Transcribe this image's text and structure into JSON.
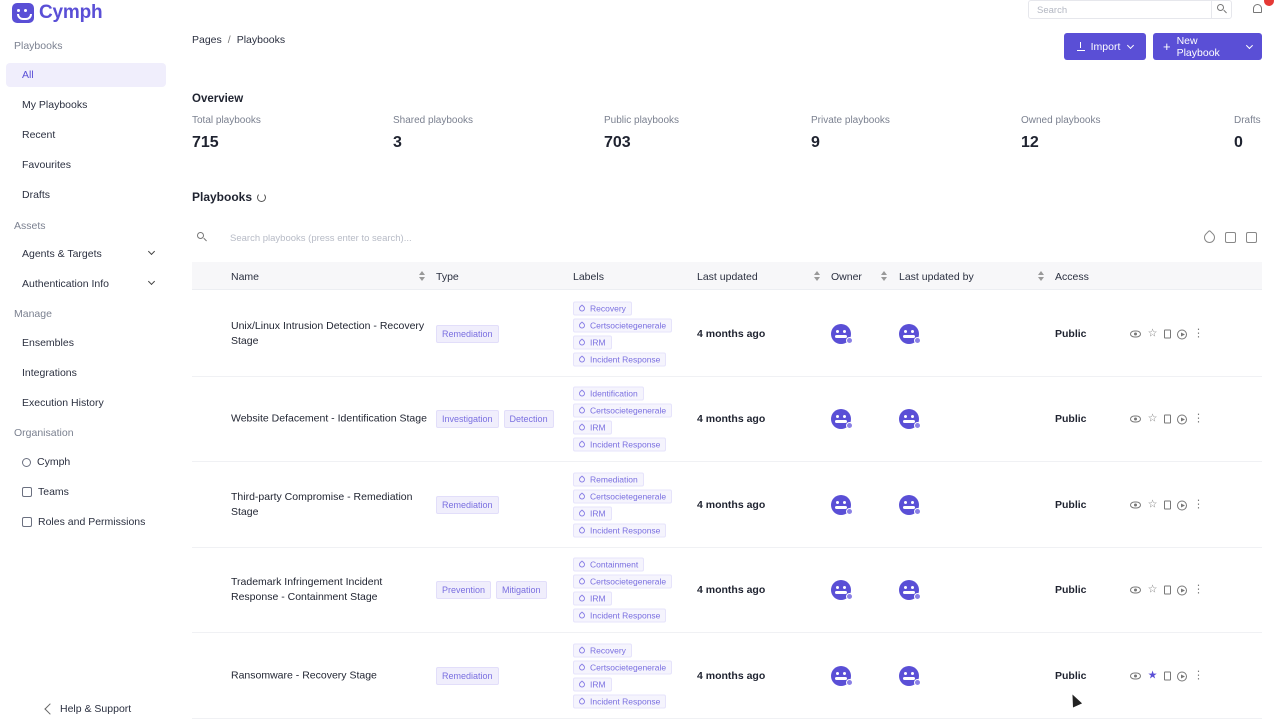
{
  "app": {
    "name": "Cymph"
  },
  "sidebar": {
    "sections": [
      {
        "label": "Playbooks"
      },
      {
        "label": "Assets"
      },
      {
        "label": "Manage"
      },
      {
        "label": "Organisation"
      }
    ],
    "playbooks": [
      {
        "label": "All",
        "active": true
      },
      {
        "label": "My Playbooks"
      },
      {
        "label": "Recent"
      },
      {
        "label": "Favourites"
      },
      {
        "label": "Drafts"
      }
    ],
    "assets": [
      {
        "label": "Agents & Targets"
      },
      {
        "label": "Authentication Info"
      }
    ],
    "manage": [
      {
        "label": "Ensembles"
      },
      {
        "label": "Integrations"
      },
      {
        "label": "Execution History"
      }
    ],
    "organisation": [
      {
        "label": "Cymph",
        "icon": "people-icon"
      },
      {
        "label": "Teams",
        "icon": "teams-icon"
      },
      {
        "label": "Roles and Permissions",
        "icon": "roles-icon"
      }
    ],
    "help": "Help & Support"
  },
  "topbar": {
    "search_placeholder": "Search"
  },
  "breadcrumb": [
    "Pages",
    "/",
    "Playbooks"
  ],
  "buttons": {
    "import": "Import",
    "new_playbook": "New Playbook"
  },
  "overview": {
    "title": "Overview",
    "stats": [
      {
        "label": "Total playbooks",
        "value": "715"
      },
      {
        "label": "Shared playbooks",
        "value": "3"
      },
      {
        "label": "Public playbooks",
        "value": "703"
      },
      {
        "label": "Private playbooks",
        "value": "9"
      },
      {
        "label": "Owned playbooks",
        "value": "12"
      },
      {
        "label": "Drafts",
        "value": "0"
      }
    ]
  },
  "playbooks": {
    "title": "Playbooks",
    "search_placeholder": "Search playbooks (press enter to search)...",
    "columns": [
      "Name",
      "Type",
      "Labels",
      "Last updated",
      "Owner",
      "Last updated by",
      "Access"
    ],
    "rows": [
      {
        "name": "Unix/Linux Intrusion Detection - Recovery Stage",
        "types": [
          "Remediation"
        ],
        "labels": [
          "Recovery",
          "Certsocietegenerale",
          "IRM",
          "Incident Response"
        ],
        "last_updated": "4 months ago",
        "access": "Public",
        "favourite": false
      },
      {
        "name": "Website Defacement - Identification Stage",
        "types": [
          "Investigation",
          "Detection"
        ],
        "labels": [
          "Identification",
          "Certsocietegenerale",
          "IRM",
          "Incident Response"
        ],
        "last_updated": "4 months ago",
        "access": "Public",
        "favourite": false
      },
      {
        "name": "Third-party Compromise - Remediation Stage",
        "types": [
          "Remediation"
        ],
        "labels": [
          "Remediation",
          "Certsocietegenerale",
          "IRM",
          "Incident Response"
        ],
        "last_updated": "4 months ago",
        "access": "Public",
        "favourite": false
      },
      {
        "name": "Trademark Infringement Incident Response - Containment Stage",
        "types": [
          "Prevention",
          "Mitigation"
        ],
        "labels": [
          "Containment",
          "Certsocietegenerale",
          "IRM",
          "Incident Response"
        ],
        "last_updated": "4 months ago",
        "access": "Public",
        "favourite": false
      },
      {
        "name": "Ransomware - Recovery Stage",
        "types": [
          "Remediation"
        ],
        "labels": [
          "Recovery",
          "Certsocietegenerale",
          "IRM",
          "Incident Response"
        ],
        "last_updated": "4 months ago",
        "access": "Public",
        "favourite": true
      }
    ]
  },
  "colors": {
    "accent": "#5a4fd6",
    "tag_bg": "#f0eefc",
    "header_bg": "#f7f7f9"
  }
}
